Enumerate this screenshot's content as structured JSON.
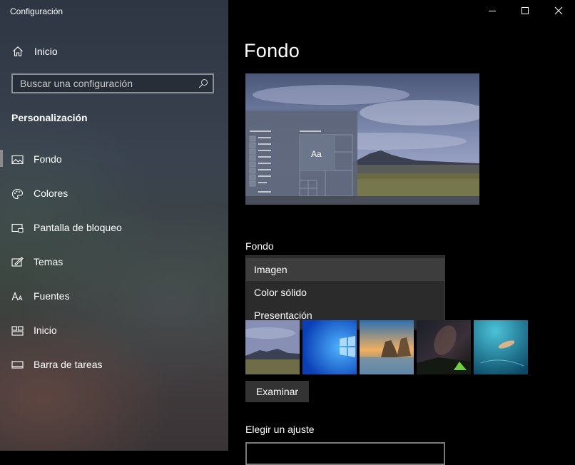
{
  "window": {
    "title": "Configuración"
  },
  "sidebar": {
    "home_label": "Inicio",
    "search_placeholder": "Buscar una configuración",
    "section_title": "Personalización",
    "items": [
      {
        "label": "Fondo",
        "icon": "picture-icon",
        "active": true
      },
      {
        "label": "Colores",
        "icon": "palette-icon"
      },
      {
        "label": "Pantalla de bloqueo",
        "icon": "lock-screen-icon"
      },
      {
        "label": "Temas",
        "icon": "themes-icon"
      },
      {
        "label": "Fuentes",
        "icon": "fonts-icon"
      },
      {
        "label": "Inicio",
        "icon": "start-icon"
      },
      {
        "label": "Barra de tareas",
        "icon": "taskbar-icon"
      }
    ]
  },
  "main": {
    "title": "Fondo",
    "preview_tile_text": "Aa",
    "background_label": "Fondo",
    "background_options": [
      "Imagen",
      "Color sólido",
      "Presentación"
    ],
    "background_selected": "Imagen",
    "browse_label": "Examinar",
    "fit_label": "Elegir un ajuste"
  },
  "colors": {
    "accent_selected": "#3d3d3d",
    "sidebar_top": "#2e3644",
    "main_bg": "#000000"
  }
}
